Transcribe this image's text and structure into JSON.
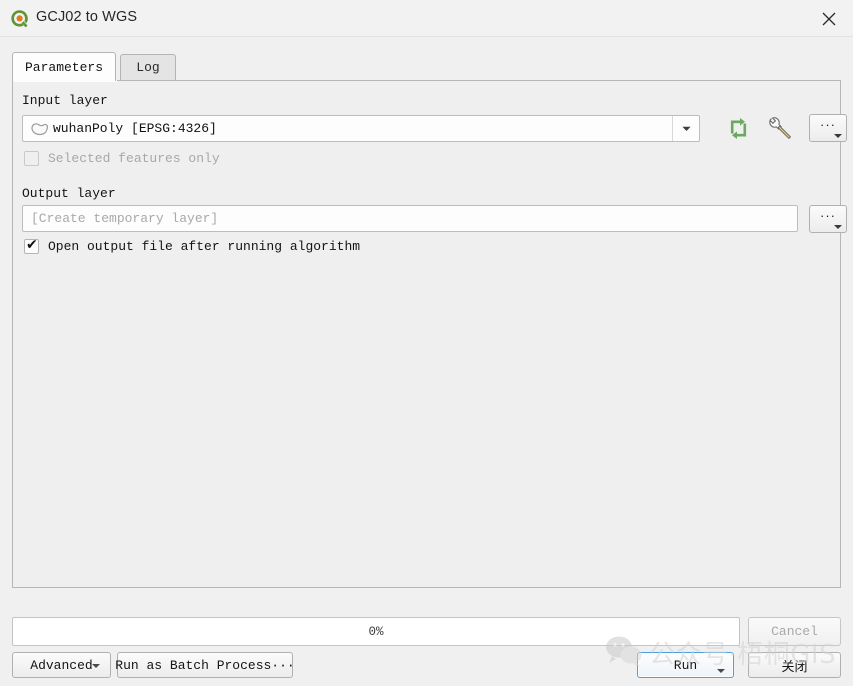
{
  "window": {
    "title": "GCJ02 to WGS",
    "app_icon": "qgis-logo-icon",
    "close_icon": "close-icon"
  },
  "tabs": [
    {
      "label": "Parameters",
      "active": true
    },
    {
      "label": "Log",
      "active": false
    }
  ],
  "parameters": {
    "input_layer": {
      "label": "Input layer",
      "value": "wuhanPoly [EPSG:4326]",
      "layer_icon": "polygon-layer-icon",
      "dropdown_icon": "chevron-down-icon",
      "iterate_icon": "iterate-icon",
      "wrench_icon": "wrench-icon",
      "browse_label": "···"
    },
    "selected_features_only": {
      "label": "Selected features only",
      "checked": false,
      "enabled": false
    },
    "output_layer": {
      "label": "Output layer",
      "value": "",
      "placeholder": "[Create temporary layer]",
      "browse_label": "···"
    },
    "open_output": {
      "label": "Open output file after running algorithm",
      "checked": true,
      "check_glyph": "✔"
    }
  },
  "footer": {
    "progress_text": "0%",
    "progress_percent": 0,
    "cancel_label": "Cancel",
    "cancel_enabled": false,
    "advanced_label": "Advanced",
    "batch_label": "Run as Batch Process···",
    "run_label": "Run",
    "close_label": "关闭"
  },
  "watermark": {
    "text": "公众号·梧桐GIS",
    "icon": "wechat-icon"
  },
  "colors": {
    "accent_focus": "#4a9fe0",
    "qgis_green": "#5f9537",
    "qgis_orange": "#e07b1e",
    "iterate_green": "#6aa95f",
    "wrench_yellow": "#e9d88a",
    "dialog_bg": "#f0f0f0",
    "panel_bg": "#efefef"
  }
}
